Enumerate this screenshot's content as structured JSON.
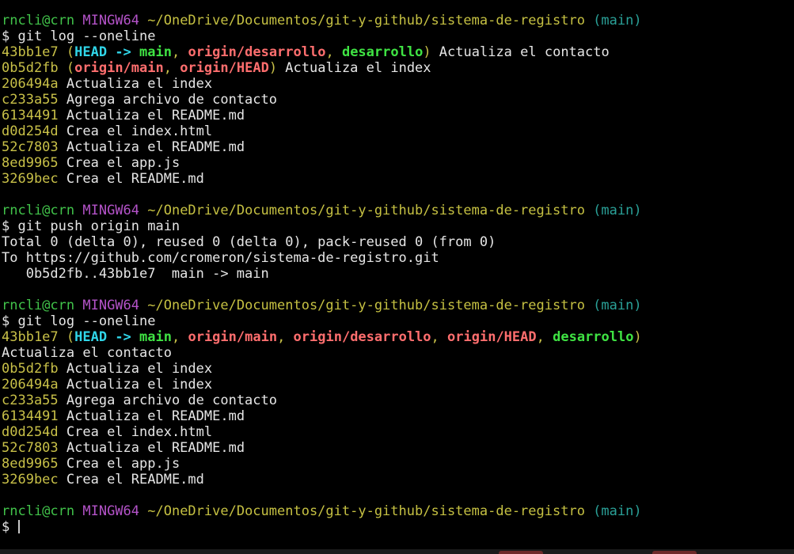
{
  "window": {
    "background": "#000000"
  },
  "colors": {
    "default": "#e6e6e6",
    "user": "#41c34a",
    "mingw": "#b453c9",
    "path": "#c5c042",
    "branch_paren": "#2aa198",
    "hash": "#c8c048",
    "head": "#30d5e8",
    "local_branch": "#3fe343",
    "remote_branch": "#ff6e6e"
  },
  "terminal": {
    "lines": [
      [
        {
          "t": "rncli@crn ",
          "c": "user"
        },
        {
          "t": "MINGW64 ",
          "c": "mingw"
        },
        {
          "t": "~/OneDrive/Documentos/git-y-github/sistema-de-registro ",
          "c": "path"
        },
        {
          "t": "(main)",
          "c": "branch_paren"
        }
      ],
      [
        {
          "t": "$ git log --oneline",
          "c": "default"
        }
      ],
      [
        {
          "t": "43bb1e7 ",
          "c": "hash"
        },
        {
          "t": "(",
          "c": "hash"
        },
        {
          "t": "HEAD -> ",
          "c": "head",
          "b": true
        },
        {
          "t": "main",
          "c": "local_branch",
          "b": true
        },
        {
          "t": ", ",
          "c": "hash"
        },
        {
          "t": "origin/desarrollo",
          "c": "remote_branch",
          "b": true
        },
        {
          "t": ", ",
          "c": "hash"
        },
        {
          "t": "desarrollo",
          "c": "local_branch",
          "b": true
        },
        {
          "t": ")",
          "c": "hash"
        },
        {
          "t": " Actualiza el contacto",
          "c": "default"
        }
      ],
      [
        {
          "t": "0b5d2fb ",
          "c": "hash"
        },
        {
          "t": "(",
          "c": "hash"
        },
        {
          "t": "origin/main",
          "c": "remote_branch",
          "b": true
        },
        {
          "t": ", ",
          "c": "hash"
        },
        {
          "t": "origin/HEAD",
          "c": "remote_branch",
          "b": true
        },
        {
          "t": ")",
          "c": "hash"
        },
        {
          "t": " Actualiza el index",
          "c": "default"
        }
      ],
      [
        {
          "t": "206494a ",
          "c": "hash"
        },
        {
          "t": "Actualiza el index",
          "c": "default"
        }
      ],
      [
        {
          "t": "c233a55 ",
          "c": "hash"
        },
        {
          "t": "Agrega archivo de contacto",
          "c": "default"
        }
      ],
      [
        {
          "t": "6134491 ",
          "c": "hash"
        },
        {
          "t": "Actualiza el README.md",
          "c": "default"
        }
      ],
      [
        {
          "t": "d0d254d ",
          "c": "hash"
        },
        {
          "t": "Crea el index.html",
          "c": "default"
        }
      ],
      [
        {
          "t": "52c7803 ",
          "c": "hash"
        },
        {
          "t": "Actualiza el README.md",
          "c": "default"
        }
      ],
      [
        {
          "t": "8ed9965 ",
          "c": "hash"
        },
        {
          "t": "Crea el app.js",
          "c": "default"
        }
      ],
      [
        {
          "t": "3269bec ",
          "c": "hash"
        },
        {
          "t": "Crea el README.md",
          "c": "default"
        }
      ],
      [],
      [
        {
          "t": "rncli@crn ",
          "c": "user"
        },
        {
          "t": "MINGW64 ",
          "c": "mingw"
        },
        {
          "t": "~/OneDrive/Documentos/git-y-github/sistema-de-registro ",
          "c": "path"
        },
        {
          "t": "(main)",
          "c": "branch_paren"
        }
      ],
      [
        {
          "t": "$ git push origin main",
          "c": "default"
        }
      ],
      [
        {
          "t": "Total 0 (delta 0), reused 0 (delta 0), pack-reused 0 (from 0)",
          "c": "default"
        }
      ],
      [
        {
          "t": "To https://github.com/cromeron/sistema-de-registro.git",
          "c": "default"
        }
      ],
      [
        {
          "t": "   0b5d2fb..43bb1e7  main -> main",
          "c": "default"
        }
      ],
      [],
      [
        {
          "t": "rncli@crn ",
          "c": "user"
        },
        {
          "t": "MINGW64 ",
          "c": "mingw"
        },
        {
          "t": "~/OneDrive/Documentos/git-y-github/sistema-de-registro ",
          "c": "path"
        },
        {
          "t": "(main)",
          "c": "branch_paren"
        }
      ],
      [
        {
          "t": "$ git log --oneline",
          "c": "default"
        }
      ],
      [
        {
          "t": "43bb1e7 ",
          "c": "hash"
        },
        {
          "t": "(",
          "c": "hash"
        },
        {
          "t": "HEAD -> ",
          "c": "head",
          "b": true
        },
        {
          "t": "main",
          "c": "local_branch",
          "b": true
        },
        {
          "t": ", ",
          "c": "hash"
        },
        {
          "t": "origin/main",
          "c": "remote_branch",
          "b": true
        },
        {
          "t": ", ",
          "c": "hash"
        },
        {
          "t": "origin/desarrollo",
          "c": "remote_branch",
          "b": true
        },
        {
          "t": ", ",
          "c": "hash"
        },
        {
          "t": "origin/HEAD",
          "c": "remote_branch",
          "b": true
        },
        {
          "t": ", ",
          "c": "hash"
        },
        {
          "t": "desarrollo",
          "c": "local_branch",
          "b": true
        },
        {
          "t": ")",
          "c": "hash"
        }
      ],
      [
        {
          "t": "Actualiza el contacto",
          "c": "default"
        }
      ],
      [
        {
          "t": "0b5d2fb ",
          "c": "hash"
        },
        {
          "t": "Actualiza el index",
          "c": "default"
        }
      ],
      [
        {
          "t": "206494a ",
          "c": "hash"
        },
        {
          "t": "Actualiza el index",
          "c": "default"
        }
      ],
      [
        {
          "t": "c233a55 ",
          "c": "hash"
        },
        {
          "t": "Agrega archivo de contacto",
          "c": "default"
        }
      ],
      [
        {
          "t": "6134491 ",
          "c": "hash"
        },
        {
          "t": "Actualiza el README.md",
          "c": "default"
        }
      ],
      [
        {
          "t": "d0d254d ",
          "c": "hash"
        },
        {
          "t": "Crea el index.html",
          "c": "default"
        }
      ],
      [
        {
          "t": "52c7803 ",
          "c": "hash"
        },
        {
          "t": "Actualiza el README.md",
          "c": "default"
        }
      ],
      [
        {
          "t": "8ed9965 ",
          "c": "hash"
        },
        {
          "t": "Crea el app.js",
          "c": "default"
        }
      ],
      [
        {
          "t": "3269bec ",
          "c": "hash"
        },
        {
          "t": "Crea el README.md",
          "c": "default"
        }
      ],
      [],
      [
        {
          "t": "rncli@crn ",
          "c": "user"
        },
        {
          "t": "MINGW64 ",
          "c": "mingw"
        },
        {
          "t": "~/OneDrive/Documentos/git-y-github/sistema-de-registro ",
          "c": "path"
        },
        {
          "t": "(main)",
          "c": "branch_paren"
        }
      ]
    ],
    "input_line": {
      "prompt": "$ ",
      "value": ""
    }
  }
}
